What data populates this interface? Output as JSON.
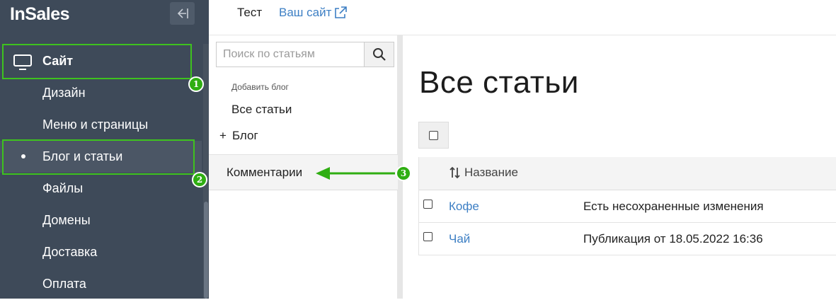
{
  "app": {
    "logo": "InSales"
  },
  "sidebar": {
    "items": [
      {
        "label": "Сайт"
      },
      {
        "label": "Дизайн"
      },
      {
        "label": "Меню и страницы"
      },
      {
        "label": "Блог и статьи"
      },
      {
        "label": "Файлы"
      },
      {
        "label": "Домены"
      },
      {
        "label": "Доставка"
      },
      {
        "label": "Оплата"
      }
    ]
  },
  "topbar": {
    "store_name": "Тест",
    "site_link": "Ваш сайт"
  },
  "blog_panel": {
    "search_placeholder": "Поиск по статьям",
    "add_blog": "Добавить блог",
    "all_posts": "Все статьи",
    "blog_prefix": "+",
    "blog": "Блог",
    "comments": "Комментарии"
  },
  "main": {
    "title": "Все статьи",
    "table": {
      "column_name": "Название",
      "rows": [
        {
          "name": "Кофе",
          "status": "Есть несохраненные изменения"
        },
        {
          "name": "Чай",
          "status": "Публикация от 18.05.2022 16:36"
        }
      ]
    }
  },
  "annotations": {
    "badge_1": "1",
    "badge_2": "2",
    "badge_3": "3",
    "color": "#3ec21e"
  },
  "colors": {
    "sidebar_bg": "#3e4a59",
    "link": "#3d7fc4",
    "highlight": "#3ec21e"
  }
}
